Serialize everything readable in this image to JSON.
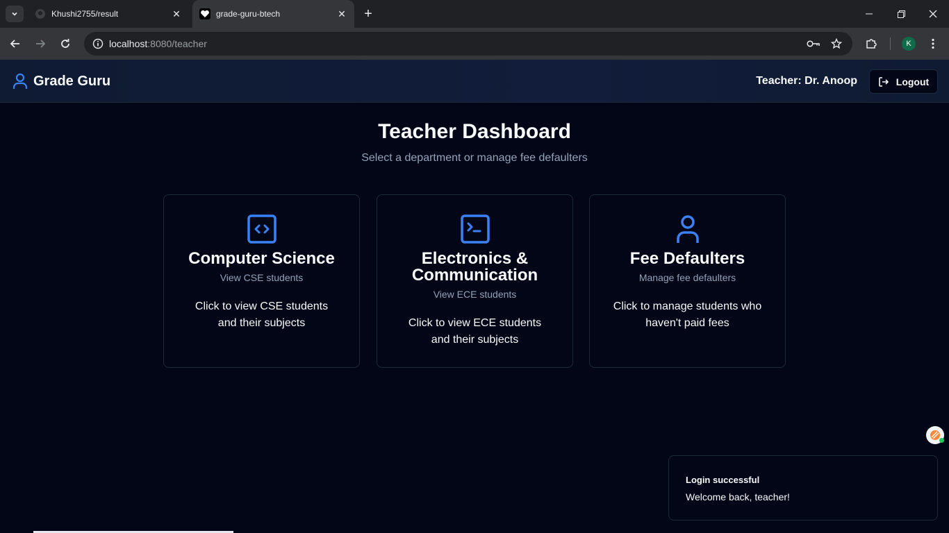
{
  "browser": {
    "tabs": [
      {
        "title": "Khushi2755/result",
        "active": false,
        "icon": "github-icon"
      },
      {
        "title": "grade-guru-btech",
        "active": true,
        "icon": "heart-icon"
      }
    ],
    "url_host": "localhost",
    "url_rest": ":8080/teacher",
    "profile_initial": "K"
  },
  "header": {
    "app_name": "Grade Guru",
    "teacher_label": "Teacher: Dr. Anoop",
    "logout_label": "Logout"
  },
  "main": {
    "title": "Teacher Dashboard",
    "subtitle": "Select a department or manage fee defaulters",
    "cards": [
      {
        "title": "Computer Science",
        "subtitle": "View CSE students",
        "description": "Click to view CSE students and their subjects",
        "icon": "code-icon"
      },
      {
        "title": "Electronics & Communication",
        "subtitle": "View ECE students",
        "description": "Click to view ECE students and their subjects",
        "icon": "terminal-icon"
      },
      {
        "title": "Fee Defaulters",
        "subtitle": "Manage fee defaulters",
        "description": "Click to manage students who haven't paid fees",
        "icon": "user-icon"
      }
    ]
  },
  "toast": {
    "title": "Login successful",
    "message": "Welcome back, teacher!"
  },
  "colors": {
    "accent": "#3b82f6",
    "background": "#020617",
    "muted": "#94a3b8"
  }
}
